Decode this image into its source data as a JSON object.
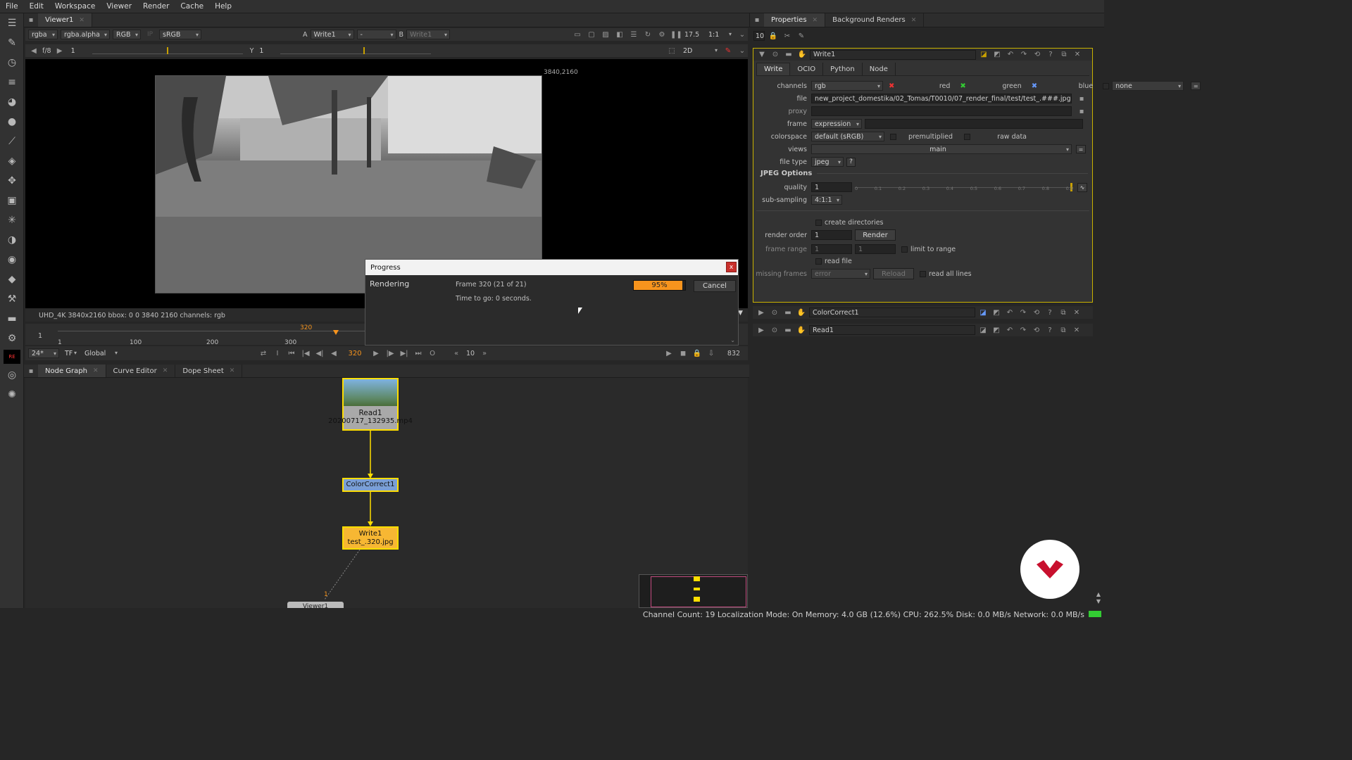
{
  "menu": [
    "File",
    "Edit",
    "Workspace",
    "Viewer",
    "Render",
    "Cache",
    "Help"
  ],
  "viewer": {
    "tab": "Viewer1",
    "channels": "rgba",
    "alpha": "rgba.alpha",
    "colorspace_mode": "RGB",
    "ip": "IP",
    "lut": "sRGB",
    "a_label": "A",
    "a_input": "Write1",
    "dash": "-",
    "b_label": "B",
    "b_input": "Write1",
    "gain_label": "f/8",
    "gain_value": "1",
    "gamma_label": "Y",
    "gamma_value": "1",
    "zoom": "17.5",
    "ratio": "1:1",
    "mode": "2D",
    "corner_coords": "3840,2160",
    "info": "UHD_4K 3840x2160  bbox: 0 0 3840 2160 channels: rgb"
  },
  "timeline": {
    "start": "1",
    "ticks": [
      "1",
      "100",
      "200",
      "300"
    ],
    "marker": "320",
    "fps": "24*",
    "tf": "TF",
    "scope": "Global",
    "current_frame": "320",
    "step": "10",
    "end_frame": "832",
    "playhead_position": 0.84
  },
  "progress": {
    "title": "Progress",
    "close": "x",
    "status": "Rendering",
    "frame": "Frame 320 (21 of 21)",
    "time": "Time to go: 0 seconds.",
    "percent_label": "95%",
    "percent": 95,
    "cancel": "Cancel"
  },
  "bottom_tabs": [
    {
      "label": "Node Graph",
      "active": true
    },
    {
      "label": "Curve Editor",
      "active": false
    },
    {
      "label": "Dope Sheet",
      "active": false
    }
  ],
  "nodes": {
    "read": {
      "name": "Read1",
      "file": "20200717_132935.mp4"
    },
    "cc": {
      "name": "ColorCorrect1"
    },
    "write": {
      "name": "Write1",
      "file": "test_.320.jpg"
    },
    "viewer": {
      "name": "Viewer1",
      "input": "1"
    }
  },
  "right_tabs": [
    {
      "label": "Properties",
      "active": true
    },
    {
      "label": "Background Renders",
      "active": false
    }
  ],
  "props_count": "10",
  "write_panel": {
    "title": "Write1",
    "tabs": [
      "Write",
      "OCIO",
      "Python",
      "Node"
    ],
    "channels_label": "channels",
    "channels": "rgb",
    "red": "red",
    "green": "green",
    "blue": "blue",
    "extra": "none",
    "file_label": "file",
    "file": "new_project_domestika/02_Tomas/T0010/07_render_final/test/test_.###.jpg",
    "proxy_label": "proxy",
    "frame_label": "frame",
    "frame": "expression",
    "colorspace_label": "colorspace",
    "colorspace": "default (sRGB)",
    "premultiplied": "premultiplied",
    "raw_data": "raw data",
    "views_label": "views",
    "views": "main",
    "filetype_label": "file type",
    "filetype": "jpeg",
    "help": "?",
    "jpeg_section": "JPEG Options",
    "quality_label": "quality",
    "quality": "1",
    "quality_ticks": [
      "0",
      "0.1",
      "0.2",
      "0.3",
      "0.4",
      "0.5",
      "0.6",
      "0.7",
      "0.8",
      "0.9"
    ],
    "subsampling_label": "sub-sampling",
    "subsampling": "4:1:1",
    "create_dirs": "create directories",
    "render_order_label": "render order",
    "render_order": "1",
    "render_btn": "Render",
    "frame_range_label": "frame range",
    "frame_range_a": "1",
    "frame_range_b": "1",
    "limit": "limit to range",
    "read_file": "read file",
    "missing_label": "missing frames",
    "missing": "error",
    "reload": "Reload",
    "read_all": "read all lines"
  },
  "collapsed_panels": [
    "ColorCorrect1",
    "Read1"
  ],
  "status_bar": "Channel Count: 19 Localization Mode: On Memory: 4.0 GB (12.6%) CPU: 262.5% Disk: 0.0 MB/s Network: 0.0 MB/s",
  "colors": {
    "accent": "#f7941d",
    "node_border": "#ffde00",
    "write_node": "#f7b733",
    "cc_node": "#7a9fd6",
    "logo": "#c8102e"
  }
}
